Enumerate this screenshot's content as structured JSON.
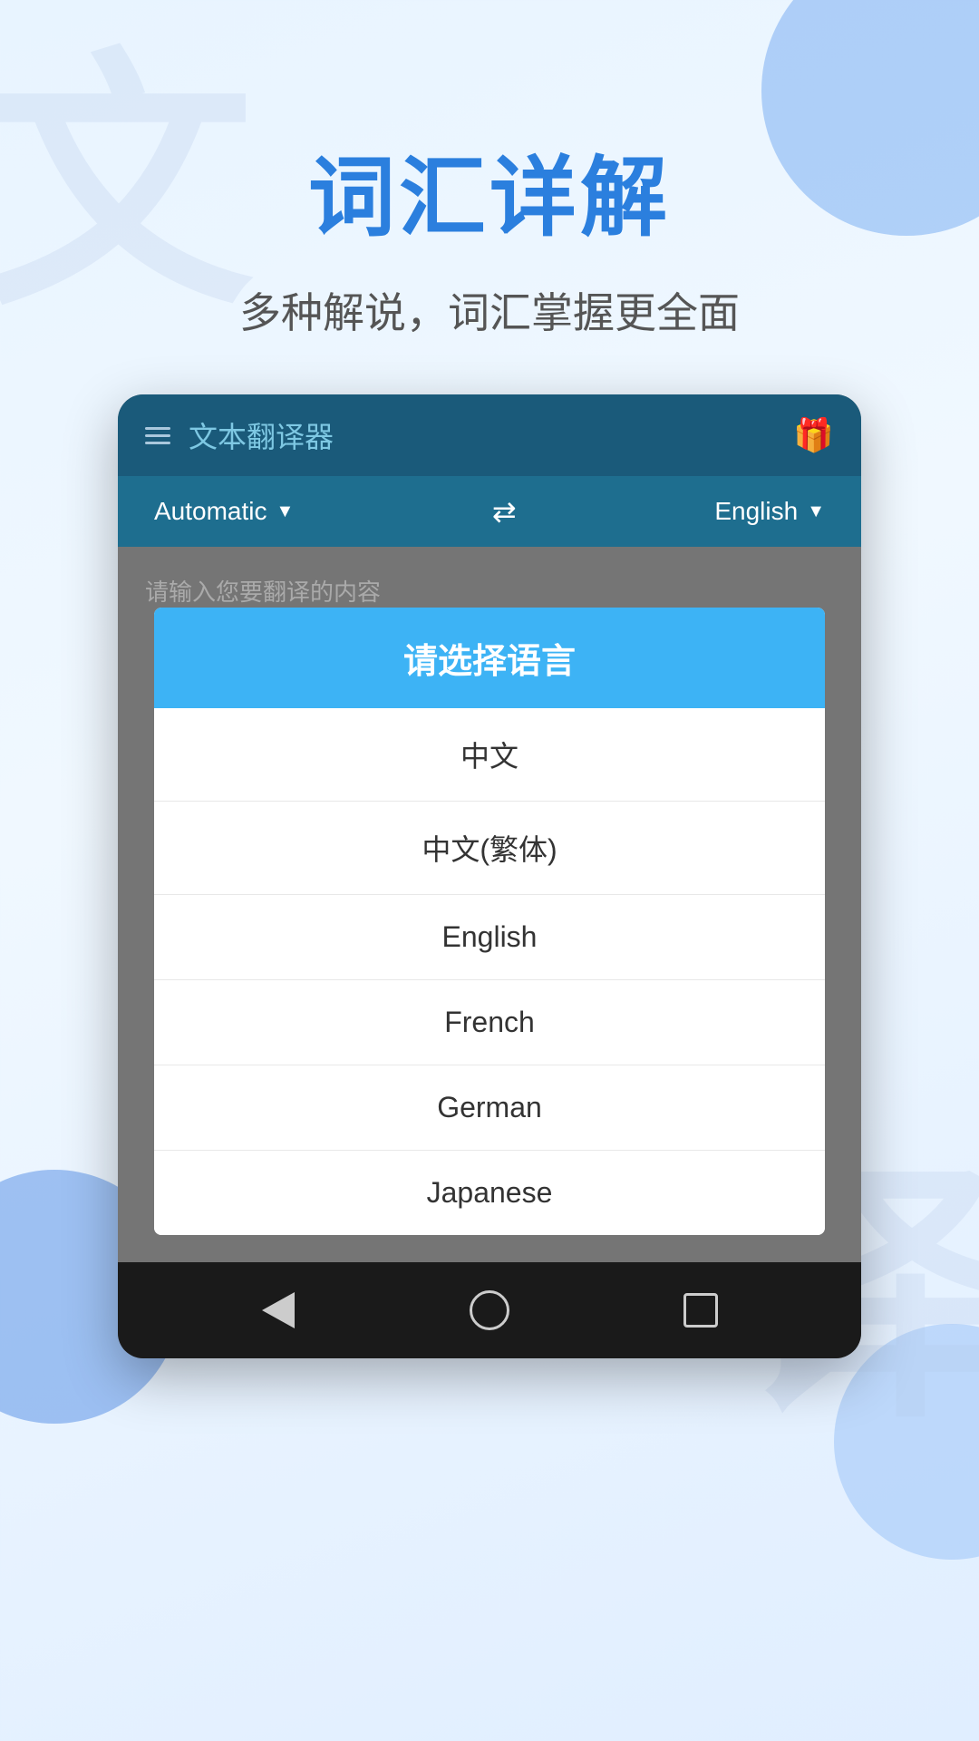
{
  "background": {
    "char_top": "文",
    "char_bottom": "译"
  },
  "header": {
    "main_title": "词汇详解",
    "subtitle": "多种解说，词汇掌握更全面"
  },
  "app": {
    "toolbar": {
      "title": "文本翻译器",
      "gift_emoji": "🎁"
    },
    "lang_bar": {
      "source_lang": "Automatic",
      "target_lang": "English",
      "swap_symbol": "⇄"
    },
    "input_placeholder": "请输入您要翻译的内容"
  },
  "dialog": {
    "title": "请选择语言",
    "options": [
      {
        "label": "中文"
      },
      {
        "label": "中文(繁体)"
      },
      {
        "label": "English"
      },
      {
        "label": "French"
      },
      {
        "label": "German"
      },
      {
        "label": "Japanese"
      }
    ]
  }
}
